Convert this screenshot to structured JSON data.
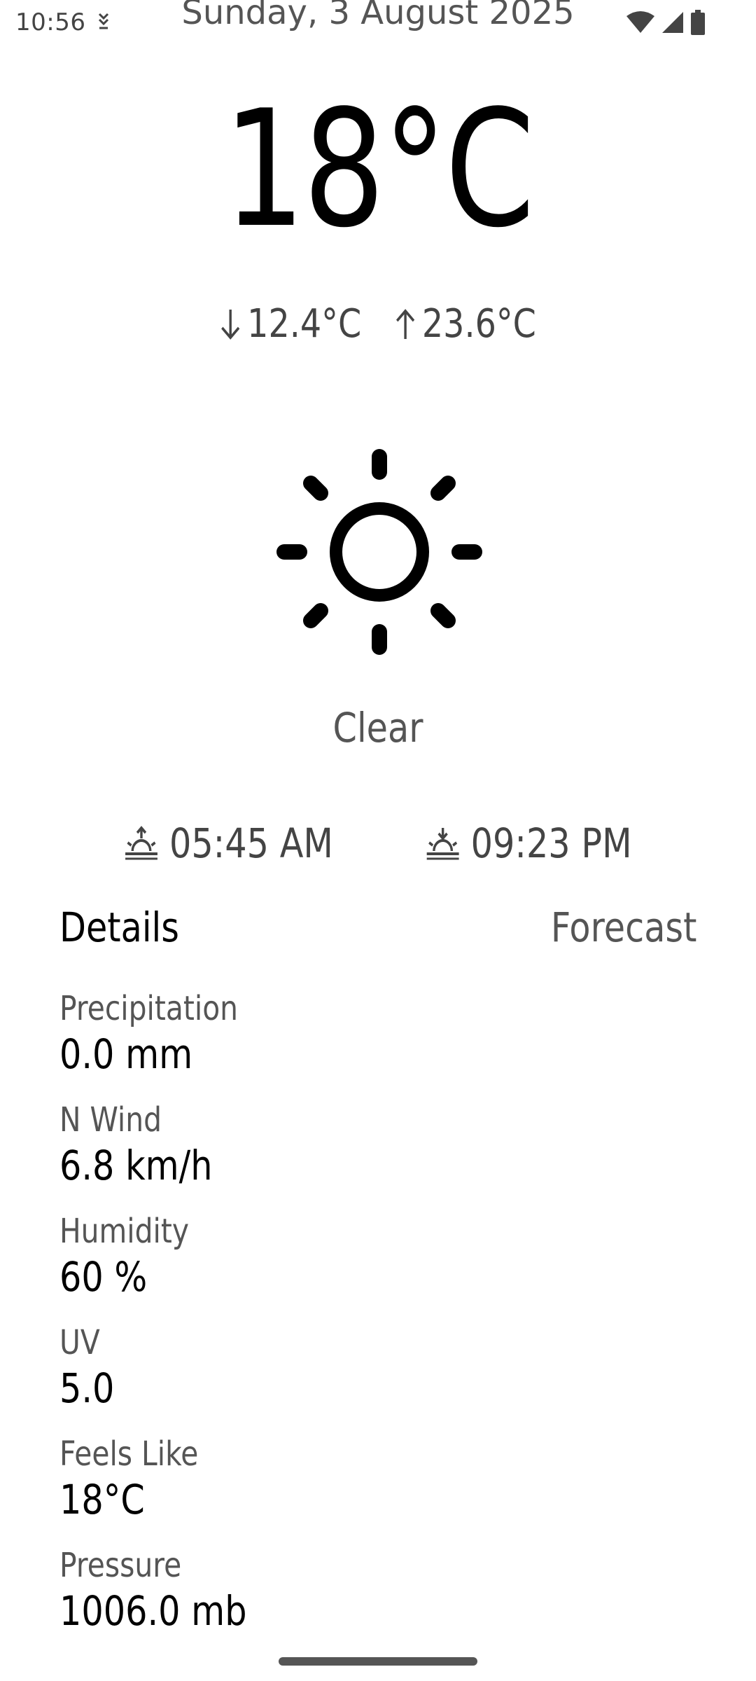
{
  "status_bar": {
    "time": "10:56"
  },
  "weather": {
    "date": "Sunday, 3 August 2025",
    "temperature": "18°C",
    "min_temp": "12.4°C",
    "max_temp": "23.6°C",
    "condition": "Clear",
    "sunrise": "05:45 AM",
    "sunset": "09:23 PM"
  },
  "tabs": {
    "details_label": "Details",
    "forecast_label": "Forecast"
  },
  "details": [
    {
      "label": "Precipitation",
      "value": "0.0 mm"
    },
    {
      "label": "N Wind",
      "value": "6.8 km/h"
    },
    {
      "label": "Humidity",
      "value": "60 %"
    },
    {
      "label": "UV",
      "value": "5.0"
    },
    {
      "label": "Feels Like",
      "value": "18°C"
    },
    {
      "label": "Pressure",
      "value": "1006.0 mb"
    }
  ],
  "icons": {
    "condition_icon": "sun-icon",
    "sunrise_icon": "sunrise-icon",
    "sunset_icon": "sunset-icon"
  }
}
